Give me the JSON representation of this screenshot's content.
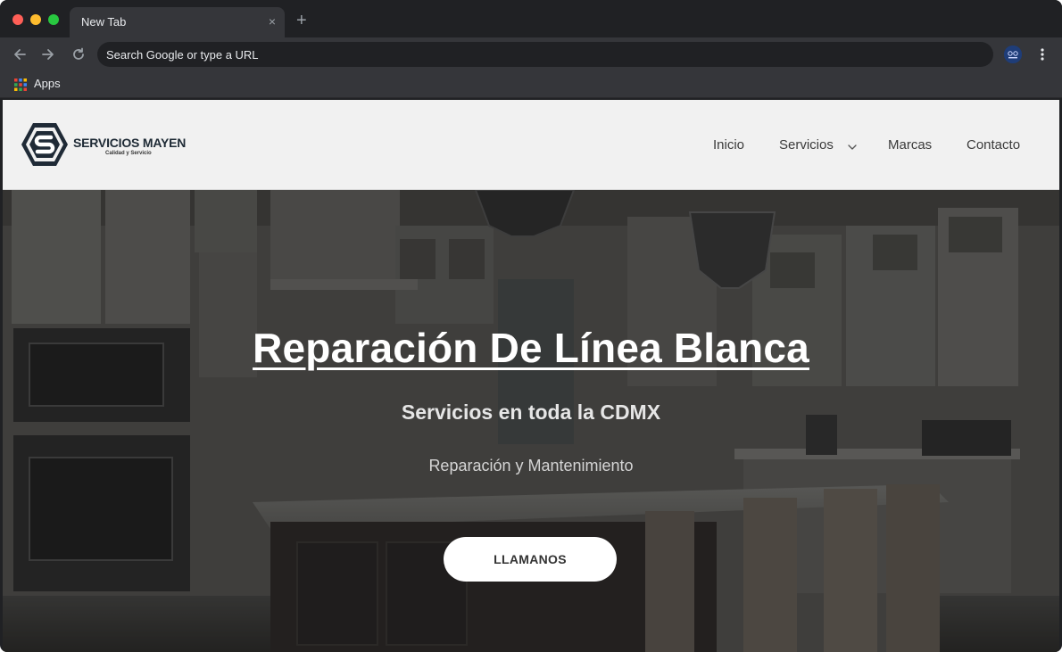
{
  "browser": {
    "tab": {
      "title": "New Tab",
      "close_glyph": "×"
    },
    "new_tab_glyph": "+",
    "omnibox": {
      "placeholder": "Search Google or type a URL",
      "value": ""
    },
    "bookmarks": [
      {
        "label": "Apps",
        "icon": "apps-grid-icon"
      }
    ]
  },
  "site": {
    "logo": {
      "name": "SERVICIOS MAYEN",
      "tagline": "Calidad y Servicio",
      "mark_letter": "S"
    },
    "nav": [
      {
        "label": "Inicio"
      },
      {
        "label": "Servicios",
        "has_dropdown": true
      },
      {
        "label": "Marcas"
      },
      {
        "label": "Contacto"
      }
    ],
    "hero": {
      "title": "Reparación De Línea Blanca",
      "subtitle": "Servicios en toda la CDMX",
      "tagline": "Reparación y Mantenimiento",
      "cta_label": "LLAMANOS"
    }
  },
  "colors": {
    "browser_frame": "#202124",
    "toolbar": "#35363a",
    "header_bg": "#f1f1f1",
    "hero_overlay": "#1a1a1a",
    "cta_bg": "#ffffff"
  }
}
